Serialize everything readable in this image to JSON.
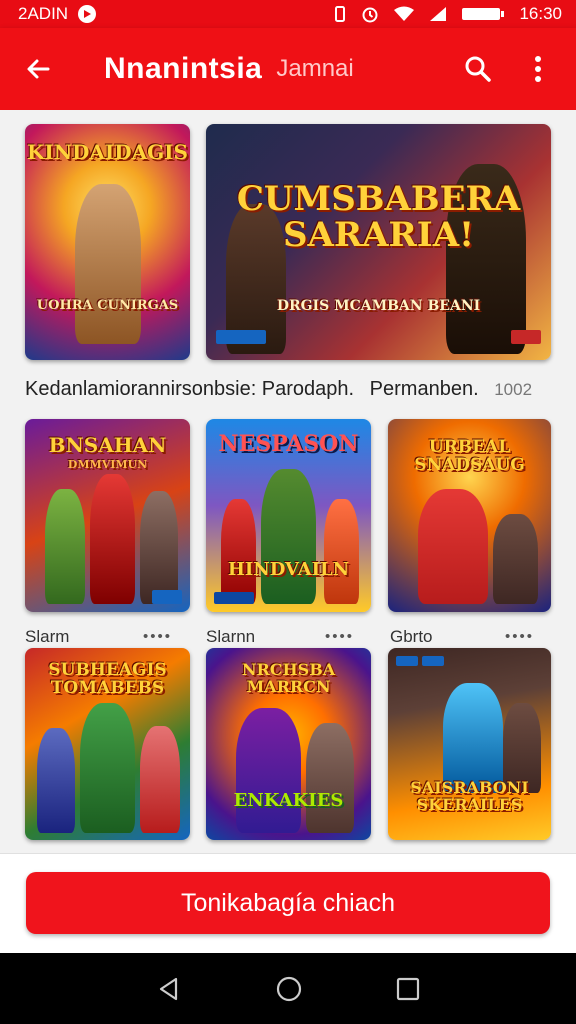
{
  "status_bar": {
    "left_text": "2ADIN",
    "time": "16:30"
  },
  "app_bar": {
    "title": "Nnanintsia",
    "subtitle": "Jamnai"
  },
  "featured_caption": {
    "main": "Kedanlamiorannirsonbsie: Parodaph.",
    "extra": "Permanben.",
    "num": "1002"
  },
  "tiles": [
    {
      "title": "KINDAIDAGIS",
      "subtitle": "UOHRA CUNIRGAS",
      "colors": [
        "#f5a623",
        "#c2185b",
        "#1e88e5"
      ]
    },
    {
      "title": "CUMSBABERA\nSARARIA!",
      "subtitle": "DRGIS MCAMBAN BEANI",
      "colors": [
        "#2b3a67",
        "#a83232",
        "#f2b544"
      ]
    },
    {
      "title": "BNSAHAN",
      "subtitle": "DMMVIMUN",
      "colors": [
        "#6a1b9a",
        "#d84315",
        "#1565c0"
      ]
    },
    {
      "title": "NESPASON",
      "subtitle": "HINDVAILN",
      "colors": [
        "#1e88e5",
        "#ffca28",
        "#e53935"
      ]
    },
    {
      "title": "URBEAL\nSNADSAUG",
      "subtitle": "",
      "colors": [
        "#ef6c00",
        "#1a237e",
        "#fdd835"
      ]
    },
    {
      "title": "SUBHEAGIS\nTOMABEBS",
      "subtitle": "",
      "colors": [
        "#c62828",
        "#2e7d32",
        "#1565c0"
      ]
    },
    {
      "title": "NRCHSBA\nMARRCN",
      "subtitle": "ENKAKIES",
      "colors": [
        "#4a148c",
        "#ff6f00",
        "#0d47a1"
      ]
    },
    {
      "title": "SAISRABONI\nSKERAILES",
      "subtitle": "",
      "colors": [
        "#3e2723",
        "#ff8f00",
        "#00838f"
      ]
    }
  ],
  "row_labels": [
    "Slarm",
    "Slarnn",
    "Gbrto"
  ],
  "cta_label": "Tonikabagía chiach"
}
